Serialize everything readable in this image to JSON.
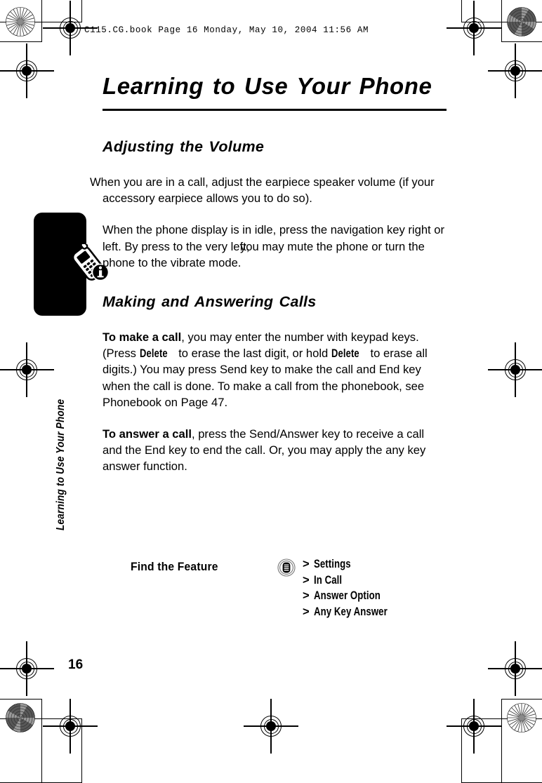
{
  "document": {
    "file_header": "C115.CG.book  Page 16  Monday, May 10, 2004  11:56 AM",
    "page_number": "16",
    "side_tab": "Learning to Use Your Phone"
  },
  "chapter": {
    "title": "Learning to Use Your Phone"
  },
  "sections": [
    {
      "heading": "Adjusting the Volume",
      "paragraphs": [
        "When you are in a call, adjust the earpiece speaker volume (if your accessory earpiece allows you to do so).",
        "When the phone display is in idle, press the navigation key right or left. By press to the very left,",
        "you may mute the phone or turn the phone to the vibrate mode."
      ]
    },
    {
      "heading": "Making and Answering Calls",
      "para_make_lead": "To make a call",
      "para_make_1": ", you may enter the number with keypad keys. (Press ",
      "key_delete_1": "Delete",
      "para_make_2": " to erase the last digit, or hold ",
      "key_delete_2": "Delete",
      "para_make_3": " to erase all digits.) You may press Send key to make the call and End key when the call is done. To make a call from the phonebook, see Phonebook on Page 47.",
      "para_answer_lead": "To answer a call",
      "para_answer_rest": ", press the Send/Answer key to receive a call and the End key to end the call. Or, you may apply the any key answer function."
    }
  ],
  "find_feature": {
    "label": "Find the Feature",
    "menu_icon": "menu-key-icon",
    "path": [
      {
        "separator": ">",
        "item": "Settings"
      },
      {
        "separator": ">",
        "item": "In Call"
      },
      {
        "separator": ">",
        "item": "Answer Option"
      },
      {
        "separator": ">",
        "item": "Any Key Answer"
      }
    ]
  },
  "margin_note": {
    "icon": "phone-with-info-badge-icon",
    "tab": "note-tab"
  },
  "print_marks": {
    "registration": "registration-target",
    "starburst": "starburst-target"
  },
  "colors": {
    "ink": "#000000",
    "paper": "#ffffff",
    "target_gray": "#6e6e6e"
  }
}
